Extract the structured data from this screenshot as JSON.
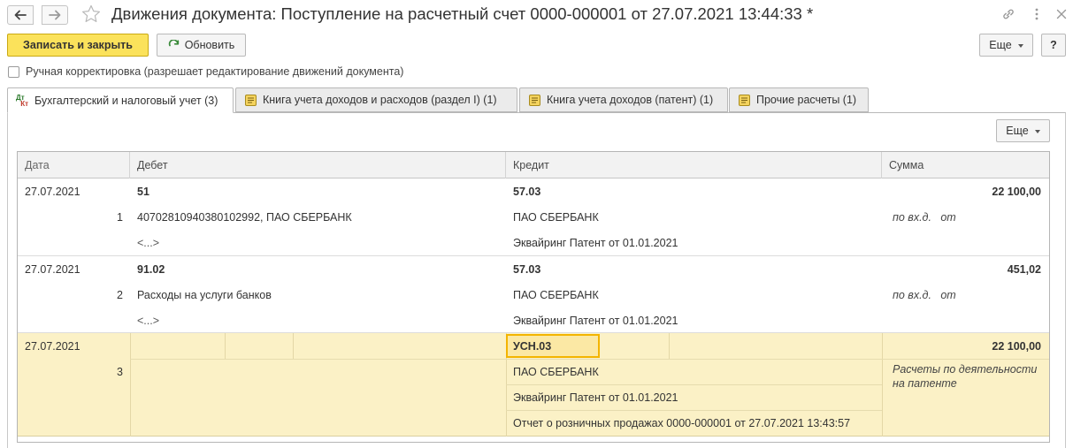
{
  "window": {
    "title": "Движения документа: Поступление на расчетный счет 0000-000001 от 27.07.2021 13:44:33 *"
  },
  "toolbar": {
    "save_close_label": "Записать и закрыть",
    "refresh_label": "Обновить",
    "more_label": "Еще",
    "help_label": "?"
  },
  "manual_correction": {
    "label": "Ручная корректировка (разрешает редактирование движений документа)",
    "checked": false
  },
  "tabs": [
    {
      "label": "Бухгалтерский и налоговый учет (3)",
      "icon": "dt-kt-icon",
      "active": true
    },
    {
      "label": "Книга учета доходов и расходов (раздел I) (1)",
      "icon": "register-icon",
      "active": false
    },
    {
      "label": "Книга учета доходов (патент) (1)",
      "icon": "register-icon",
      "active": false
    },
    {
      "label": "Прочие расчеты (1)",
      "icon": "register-icon",
      "active": false
    }
  ],
  "panel": {
    "more_label": "Еще"
  },
  "table": {
    "columns": [
      "Дата",
      "Дебет",
      "Кредит",
      "Сумма"
    ],
    "rows": [
      {
        "date": "27.07.2021",
        "num": "1",
        "debit_account": "51",
        "debit_sub1": "40702810940380102992, ПАО СБЕРБАНК",
        "debit_sub2": "<...>",
        "credit_account": "57.03",
        "credit_sub1": "ПАО СБЕРБАНК",
        "credit_sub2": "Эквайринг Патент от 01.01.2021",
        "sum": "22 100,00",
        "note": "по вх.д.   от"
      },
      {
        "date": "27.07.2021",
        "num": "2",
        "debit_account": "91.02",
        "debit_sub1": "Расходы на услуги банков",
        "debit_sub2": "<...>",
        "credit_account": "57.03",
        "credit_sub1": "ПАО СБЕРБАНК",
        "credit_sub2": "Эквайринг Патент от 01.01.2021",
        "sum": "451,02",
        "note": "по вх.д.   от"
      },
      {
        "date": "27.07.2021",
        "num": "3",
        "credit_account": "УСН.03",
        "credit_sub1": "ПАО СБЕРБАНК",
        "credit_sub2": "Эквайринг Патент от 01.01.2021",
        "credit_sub3": "Отчет о розничных продажах 0000-000001 от 27.07.2021 13:43:57",
        "sum": "22 100,00",
        "note": "Расчеты по деятельности на патенте",
        "selected": true
      }
    ]
  },
  "colors": {
    "primary_button": "#fbe25b",
    "selected_row": "#fbf1c6",
    "selected_cell_border": "#f3b400"
  }
}
